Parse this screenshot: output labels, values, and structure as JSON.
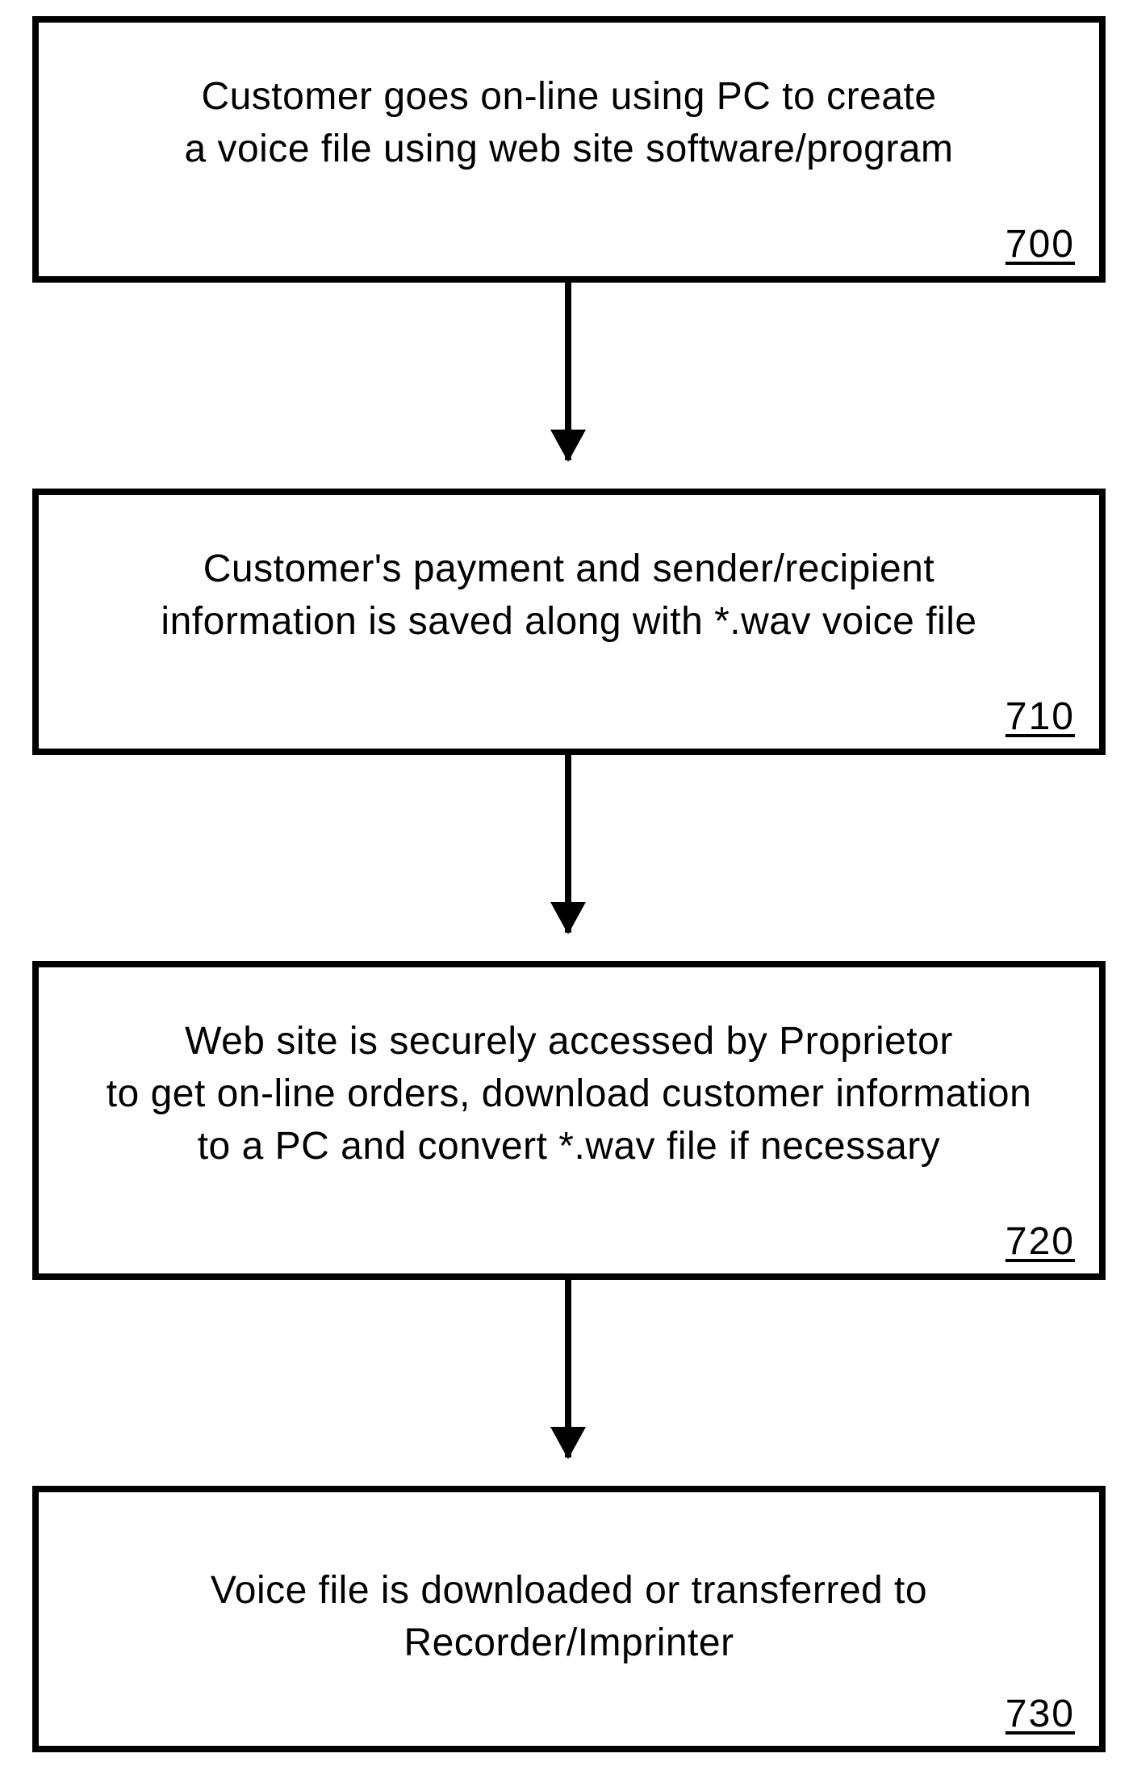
{
  "chart_data": {
    "type": "flowchart",
    "direction": "top-to-bottom",
    "nodes": [
      {
        "id": "700",
        "text": "Customer goes on-line using PC to create\na voice file using web site software/program"
      },
      {
        "id": "710",
        "text": "Customer's payment and sender/recipient\ninformation is saved along with *.wav voice file"
      },
      {
        "id": "720",
        "text": "Web site is securely accessed by Proprietor\nto get on-line orders,  download customer information\nto a PC and convert *.wav file if necessary"
      },
      {
        "id": "730",
        "text": "Voice file is downloaded or transferred to Recorder/Imprinter"
      }
    ],
    "edges": [
      {
        "from": "700",
        "to": "710"
      },
      {
        "from": "710",
        "to": "720"
      },
      {
        "from": "720",
        "to": "730"
      }
    ]
  },
  "boxes": {
    "b1": {
      "text": "Customer goes on-line using PC to create\na voice file using web site software/program",
      "ref": "700"
    },
    "b2": {
      "text": "Customer's payment and sender/recipient\ninformation is saved along with *.wav voice file",
      "ref": "710"
    },
    "b3": {
      "text": "Web site is securely accessed by Proprietor\nto get on-line orders,  download customer information\nto a PC and convert *.wav file if necessary",
      "ref": "720"
    },
    "b4": {
      "text": "Voice file is downloaded or transferred to Recorder/Imprinter",
      "ref": "730"
    }
  }
}
